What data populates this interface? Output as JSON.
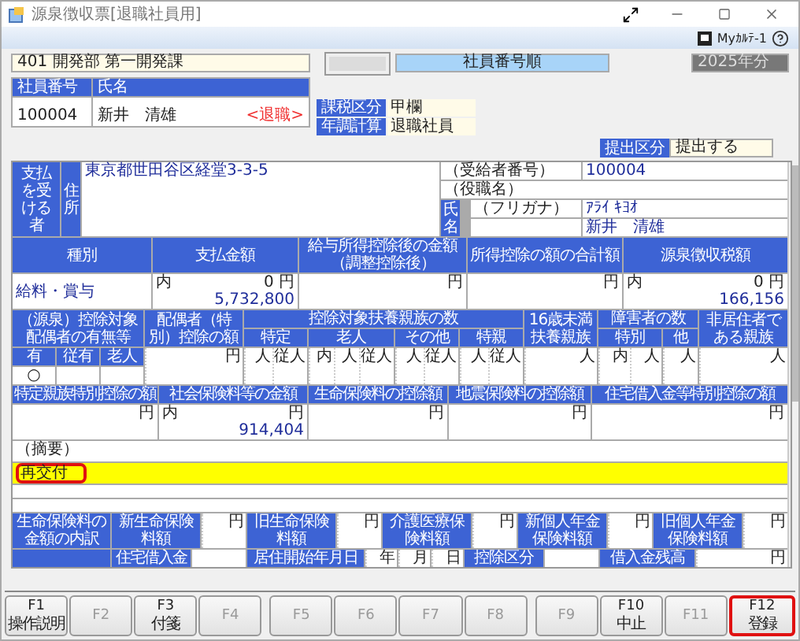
{
  "window": {
    "title": "源泉徴収票[退職社員用]"
  },
  "toolbar": {
    "mykarte": "Myｶﾙﾃ-1"
  },
  "header": {
    "department": "401 開発部 第一開発課",
    "sort_order": "社員番号順",
    "year": "2025年分"
  },
  "employee": {
    "columns": [
      "社員番号",
      "氏名"
    ],
    "number": "100004",
    "name": "新井　清雄",
    "status": "<退職>"
  },
  "attributes": [
    {
      "label": "課税区分",
      "value": "甲欄"
    },
    {
      "label": "年調計算",
      "value": "退職社員"
    }
  ],
  "submission": {
    "label": "提出区分",
    "value": "提出する"
  },
  "recipient": {
    "label": "支払を受ける者",
    "address_label": "住所",
    "address": "東京都世田谷区経堂3-3-5",
    "number_label": "（受給者番号）",
    "number": "100004",
    "title_label": "（役職名）",
    "name_label": "氏名",
    "kana_label": "（フリガナ）",
    "kana": "ｱﾗｲ ｷﾖｵ",
    "name": "新井　清雄"
  },
  "income": {
    "headers": [
      "種別",
      "支払金額",
      "給与所得控除後の金額（調整控除後）",
      "所得控除の額の合計額",
      "源泉徴収税額"
    ],
    "type": "給料・賞与",
    "values": [
      {
        "inner_label": "内",
        "inner": "0",
        "unit": "円",
        "amount": "5,732,800"
      },
      {
        "unit": "円"
      },
      {
        "unit": "円"
      },
      {
        "inner_label": "内",
        "inner": "0",
        "unit": "円",
        "amount": "166,156"
      }
    ]
  },
  "dependents": {
    "spouse_header": "（源泉）控除対象配偶者の有無等",
    "spouse_flags": [
      {
        "label": "有",
        "mark": "○"
      },
      {
        "label": "従有"
      },
      {
        "label": "老人"
      }
    ],
    "spouse_deduction": {
      "header": "配偶者（特別）控除の額",
      "unit": "円"
    },
    "dependents_header": "控除対象扶養親族の数",
    "groups": [
      {
        "label": "特定",
        "units": [
          "人",
          "従人"
        ]
      },
      {
        "label": "老人",
        "units": [
          "内",
          "人",
          "従人"
        ]
      },
      {
        "label": "その他",
        "units": [
          "人",
          "従人"
        ]
      },
      {
        "label": "特親",
        "units": [
          "人",
          "従人"
        ]
      }
    ],
    "under16": {
      "header": "16歳未満扶養親族",
      "units": [
        "人"
      ]
    },
    "disabled_header": "障害者の数",
    "disabled_groups": [
      {
        "label": "特別",
        "units": [
          "内",
          "人"
        ]
      },
      {
        "label": "他",
        "units": [
          "人"
        ]
      }
    ],
    "nonresident": {
      "header": "非居住者である親族",
      "units": [
        "人"
      ]
    }
  },
  "deductions": [
    {
      "header": "特定親族特別控除の額",
      "unit": "円"
    },
    {
      "header": "社会保険料等の金額",
      "inner_label": "内",
      "unit": "円",
      "amount": "914,404"
    },
    {
      "header": "生命保険料の控除額",
      "unit": "円"
    },
    {
      "header": "地震保険料の控除額",
      "unit": "円"
    },
    {
      "header": "住宅借入金等特別控除の額",
      "unit": "円"
    }
  ],
  "remarks": {
    "label": "（摘要）",
    "lines": [
      {
        "text": "再交付",
        "highlighted": true,
        "callout": true
      }
    ]
  },
  "insurance": {
    "title": "生命保険料の金額の内訳",
    "items": [
      {
        "label": "新生命保険料額",
        "unit": "円"
      },
      {
        "label": "旧生命保険料額",
        "unit": "円"
      },
      {
        "label": "介護医療保険料額",
        "unit": "円"
      },
      {
        "label": "新個人年金保険料額",
        "unit": "円"
      },
      {
        "label": "旧個人年金保険料額",
        "unit": "円"
      }
    ]
  },
  "housing": {
    "label": "住宅借入金",
    "start_label": "居住開始年月日",
    "date_units": [
      "年",
      "月",
      "日"
    ],
    "type_label": "控除区分",
    "balance_label": "借入金残高",
    "balance_unit": "円"
  },
  "function_keys": [
    {
      "key": "F1",
      "label": "操作説明",
      "disabled": false,
      "callout": false
    },
    {
      "key": "F2",
      "disabled": true,
      "callout": false
    },
    {
      "key": "F3",
      "label": "付箋",
      "disabled": false,
      "callout": false
    },
    {
      "key": "F4",
      "disabled": true,
      "callout": false
    },
    {
      "key": "F5",
      "disabled": true,
      "callout": false
    },
    {
      "key": "F6",
      "disabled": true,
      "callout": false
    },
    {
      "key": "F7",
      "disabled": true,
      "callout": false
    },
    {
      "key": "F8",
      "disabled": true,
      "callout": false
    },
    {
      "key": "F9",
      "disabled": true,
      "callout": false
    },
    {
      "key": "F10",
      "label": "中止",
      "disabled": false,
      "callout": false
    },
    {
      "key": "F11",
      "disabled": true,
      "callout": false
    },
    {
      "key": "F12",
      "label": "登録",
      "disabled": false,
      "callout": true
    }
  ]
}
